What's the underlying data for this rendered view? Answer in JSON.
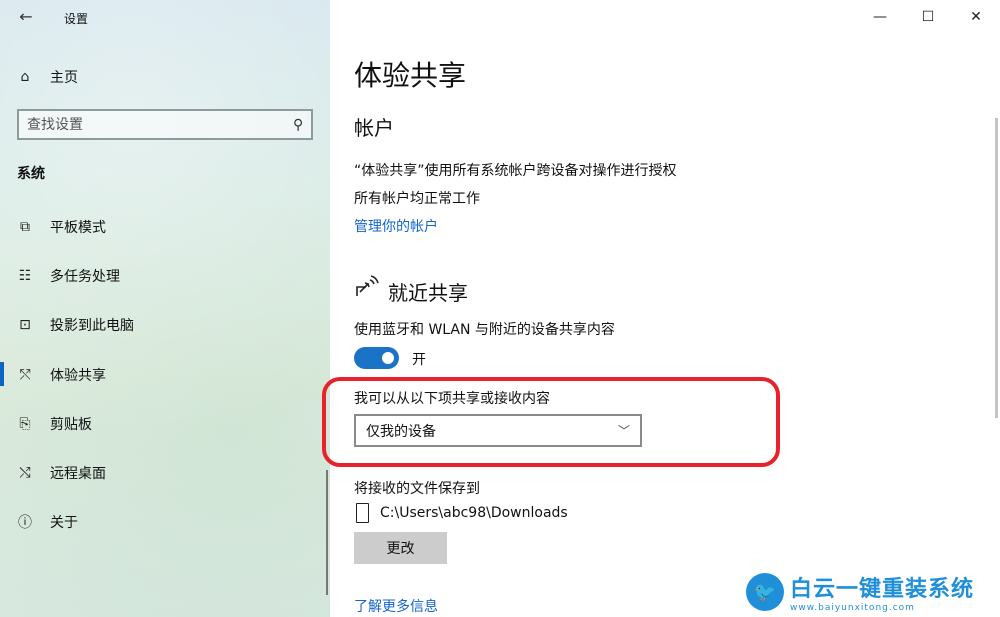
{
  "window": {
    "title": "设置",
    "minimize": "—",
    "maximize": "☐",
    "close": "✕"
  },
  "sidebar": {
    "back_icon": "←",
    "home": {
      "icon": "⌂",
      "label": "主页"
    },
    "search": {
      "placeholder": "查找设置",
      "icon": "⚲"
    },
    "section_title": "系统",
    "items": [
      {
        "icon": "⧉",
        "label": "平板模式"
      },
      {
        "icon": "☷",
        "label": "多任务处理"
      },
      {
        "icon": "⊡",
        "label": "投影到此电脑"
      },
      {
        "icon": "⤲",
        "label": "体验共享",
        "active": true
      },
      {
        "icon": "⎘",
        "label": "剪贴板"
      },
      {
        "icon": "⤭",
        "label": "远程桌面"
      },
      {
        "icon": "ⓘ",
        "label": "关于"
      }
    ]
  },
  "main": {
    "page_title": "体验共享",
    "accounts": {
      "heading": "帐户",
      "line1": "“体验共享”使用所有系统帐户跨设备对操作进行授权",
      "line2": "所有帐户均正常工作",
      "link": "管理你的帐户"
    },
    "nearby": {
      "heading": "就近共享",
      "description": "使用蓝牙和 WLAN 与附近的设备共享内容",
      "toggle_state": "开",
      "toggle_on": true,
      "share_label": "我可以从以下项共享或接收内容",
      "dropdown_value": "仅我的设备",
      "save_label": "将接收的文件保存到",
      "path": "C:\\Users\\abc98\\Downloads",
      "change_button": "更改",
      "more_link": "了解更多信息"
    }
  },
  "watermark": {
    "title": "白云一键重装系统",
    "url": "www.baiyunxitong.com"
  },
  "colors": {
    "accent": "#1a73c7",
    "link": "#1464c8",
    "highlight": "#e8222a"
  }
}
